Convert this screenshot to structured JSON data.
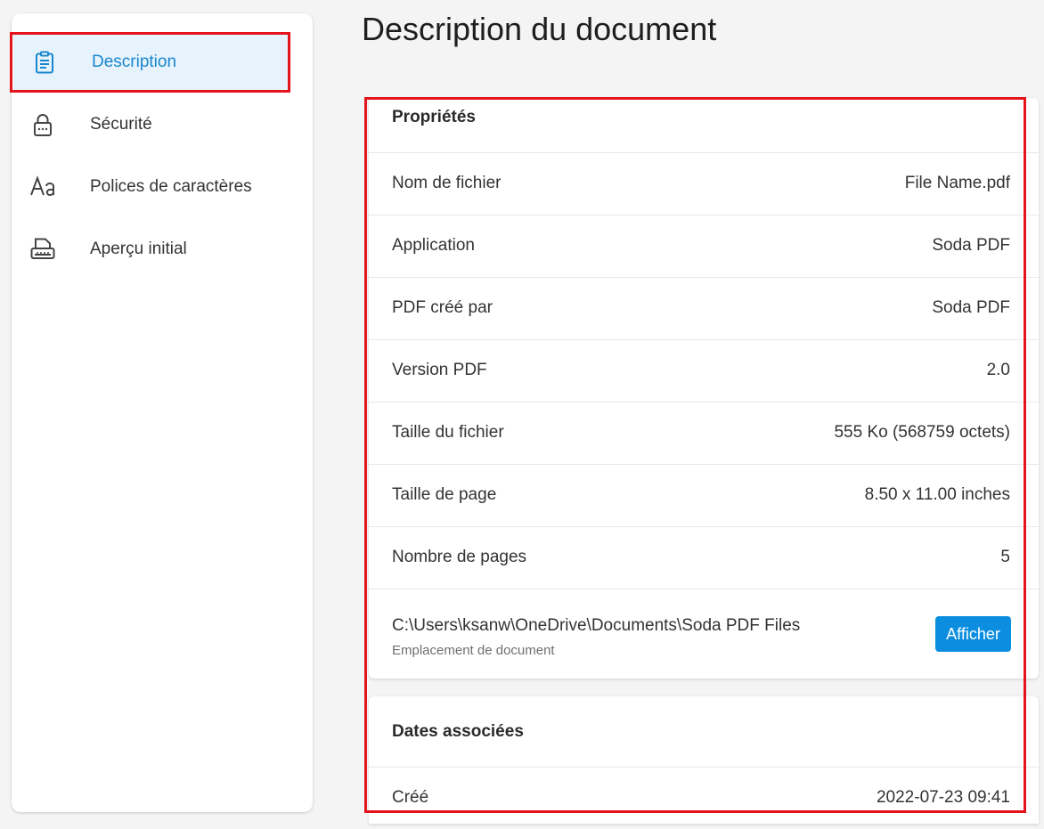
{
  "sidebar": {
    "items": [
      {
        "label": "Description",
        "icon": "clipboard-icon",
        "active": true
      },
      {
        "label": "Sécurité",
        "icon": "lock-icon",
        "active": false
      },
      {
        "label": "Polices de caractères",
        "icon": "font-icon",
        "active": false
      },
      {
        "label": "Aperçu initial",
        "icon": "printer-icon",
        "active": false
      }
    ]
  },
  "main": {
    "title": "Description du document",
    "properties": {
      "header": "Propriétés",
      "rows": [
        {
          "key": "Nom de fichier",
          "value": "File Name.pdf"
        },
        {
          "key": "Application",
          "value": "Soda PDF"
        },
        {
          "key": "PDF créé par",
          "value": "Soda PDF"
        },
        {
          "key": "Version PDF",
          "value": "2.0"
        },
        {
          "key": "Taille du fichier",
          "value": "555 Ko (568759 octets)"
        },
        {
          "key": "Taille de page",
          "value": "8.50 x 11.00 inches"
        },
        {
          "key": "Nombre de pages",
          "value": "5"
        }
      ],
      "location": {
        "path": "C:\\Users\\ksanw\\OneDrive\\Documents\\Soda PDF Files",
        "caption": "Emplacement de document",
        "button_label": "Afficher"
      }
    },
    "dates": {
      "header": "Dates associées",
      "rows": [
        {
          "key": "Créé",
          "value": "2022-07-23 09:41"
        }
      ]
    }
  },
  "colors": {
    "accent": "#1a86cf",
    "active_bg": "#e6f3fc",
    "button": "#0b8ee0",
    "highlight": "#e3141b"
  }
}
